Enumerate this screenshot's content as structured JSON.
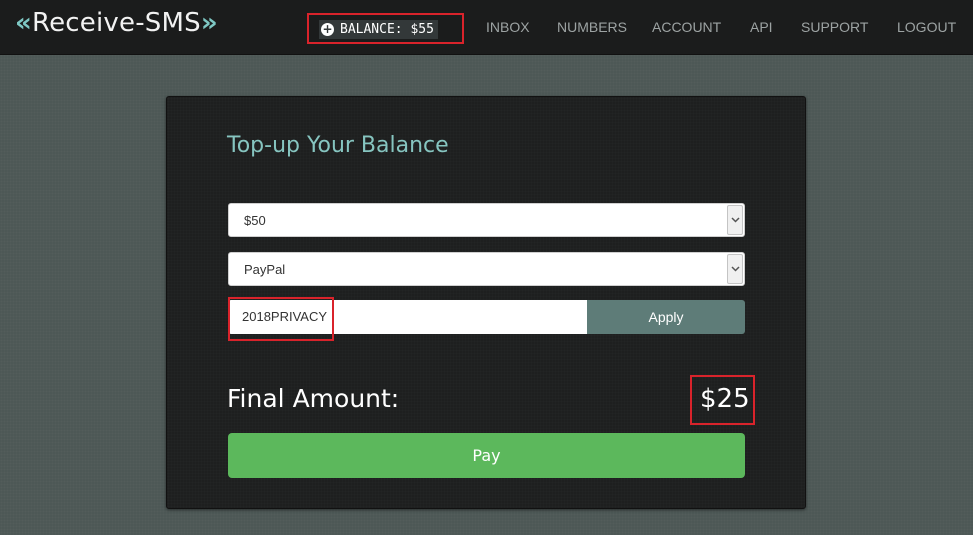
{
  "header": {
    "logo_left": "«",
    "logo_text": "Receive-SMS",
    "logo_right": "»",
    "balance_label": "BALANCE: $55",
    "balance_icon": "plus-circle-icon",
    "nav": [
      "INBOX",
      "NUMBERS",
      "ACCOUNT",
      "API",
      "SUPPORT",
      "LOGOUT"
    ]
  },
  "topup": {
    "title": "Top-up Your Balance",
    "amount_select": "$50",
    "method_select": "PayPal",
    "coupon_code": "2018PRIVACY",
    "apply_label": "Apply",
    "final_label": "Final Amount:",
    "final_amount": "$25",
    "pay_label": "Pay"
  },
  "colors": {
    "accent": "#86c5c0",
    "highlight": "#d9232b",
    "pay": "#5cb85c",
    "apply": "#5e7c78"
  }
}
